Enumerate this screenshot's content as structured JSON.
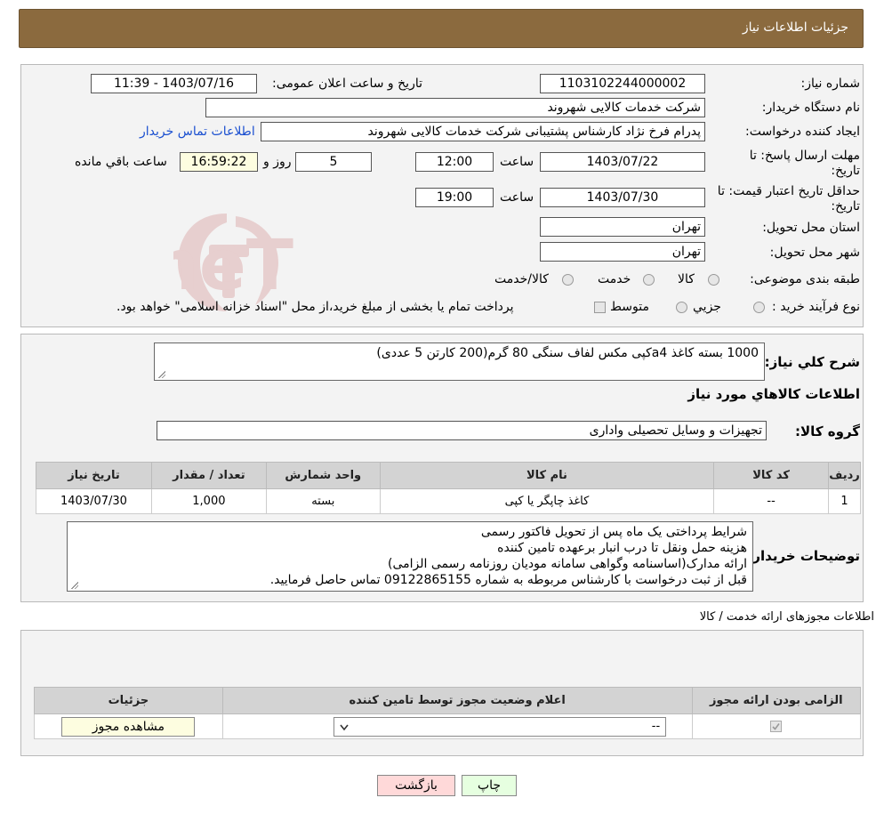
{
  "header": {
    "title": "جزئیات اطلاعات نیاز"
  },
  "need": {
    "number_label": "شماره نیاز:",
    "number": "1103102244000002",
    "announce_label": "تاریخ و ساعت اعلان عمومی:",
    "announce": "1403/07/16 - 11:39",
    "buyer_label": "نام دستگاه خریدار:",
    "buyer": "شرکت خدمات کالایی شهروند",
    "creator_label": "ایجاد کننده درخواست:",
    "creator": "پدرام فرخ نژاد کارشناس پشتیبانی شرکت خدمات کالایی شهروند",
    "contact_link": "اطلاعات تماس خریدار",
    "deadline_label_1": "مهلت ارسال پاسخ: تا",
    "deadline_label_2": "تاریخ:",
    "deadline_date": "1403/07/22",
    "time_word": "ساعت",
    "deadline_time": "12:00",
    "days_value": "5",
    "days_word": "روز و",
    "remaining_time": "16:59:22",
    "remaining_word": "ساعت باقي مانده",
    "validity_label_1": "حداقل تاریخ اعتبار قیمت: تا",
    "validity_label_2": "تاریخ:",
    "validity_date": "1403/07/30",
    "validity_time": "19:00",
    "province_label": "استان محل تحویل:",
    "province": "تهران",
    "city_label": "شهر محل تحویل:",
    "city": "تهران",
    "category_label": "طبقه بندی موضوعی:",
    "category_options": [
      "کالا",
      "خدمت",
      "کالا/خدمت"
    ],
    "process_label": "نوع فرآیند خرید :",
    "process_options": [
      "جزيي",
      "متوسط"
    ],
    "process_note": "پرداخت تمام یا بخشی از مبلغ خرید،از محل \"اسناد خزانه اسلامی\" خواهد بود."
  },
  "description": {
    "label": "شرح كلي نياز:",
    "text": "1000 بسته کاغذ a4کپی مکس لفاف سنگی 80 گرم(200 کارتن 5 عددی)"
  },
  "goods": {
    "section_title": "اطلاعات كالاهاي مورد نياز",
    "group_label": "گروه كالا:",
    "group_value": "تجهیزات و وسایل تحصیلی واداری",
    "columns": [
      "ردیف",
      "کد کالا",
      "نام کالا",
      "واحد شمارش",
      "تعداد / مقدار",
      "تاریخ نیاز"
    ],
    "rows": [
      {
        "index": "1",
        "code": "--",
        "name": "کاغذ چاپگر یا کپی",
        "unit": "بسته",
        "qty": "1,000",
        "date": "1403/07/30"
      }
    ]
  },
  "buyer_notes": {
    "label": "توضیحات خریدار:",
    "lines": [
      "شرایط پرداختی یک ماه پس از تحویل فاکتور رسمی",
      "هزینه حمل ونقل تا درب انبار برعهده تامین کننده",
      "ارائه مدارک(اساسنامه وگواهی سامانه مودیان  روزنامه رسمی الزامی)",
      "قبل از ثبت درخواست با کارشناس مربوطه به شماره 09122865155 تماس حاصل فرمایید."
    ]
  },
  "permits": {
    "section_title": "اطلاعات مجوزهای ارائه خدمت / کالا",
    "columns": [
      "الزامی بودن ارائه مجوز",
      "اعلام وضعیت مجوز توسط تامین کننده",
      "جزئیات"
    ],
    "select_value": "--",
    "view_button": "مشاهده مجوز"
  },
  "buttons": {
    "print": "چاپ",
    "back": "بازگشت"
  },
  "watermark": "AriaTender.neT",
  "colors": {
    "header_bg": "#8b6a3e",
    "panel_bg": "#f3f3f3",
    "table_header": "#d3d3d3",
    "link": "#1a4fd0",
    "back_btn": "#ffd9d9",
    "print_btn": "#e6ffe0"
  }
}
